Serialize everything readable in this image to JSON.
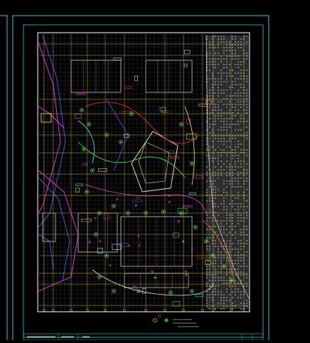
{
  "canvas": {
    "background": "#000000",
    "frame_color": "#1fd0d8",
    "paper_color": "#ffffff",
    "grid_color": "#e0d040",
    "hatch_color": "#9a9a9a"
  },
  "layer_colors": [
    "#ff3030",
    "#30ff30",
    "#ff30ff",
    "#30ffff",
    "#ffff40",
    "#ffffff",
    "#4060ff",
    "#ff9020"
  ],
  "icons": {
    "north_arrow": "compass-icon",
    "legend_symbols": [
      "circle-symbol-icon",
      "tree-symbol-icon"
    ]
  },
  "title_block": {
    "cells": [
      "",
      "",
      "",
      "",
      ""
    ]
  }
}
